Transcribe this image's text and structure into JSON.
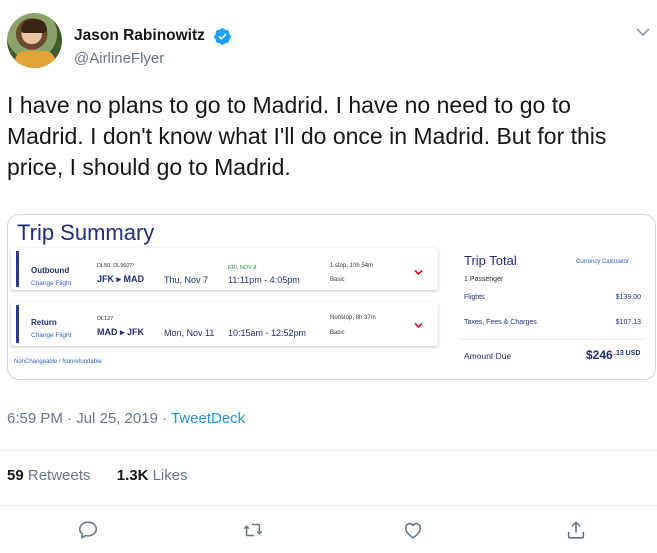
{
  "author": {
    "name": "Jason Rabinowitz",
    "handle": "@AirlineFlyer",
    "verified": true
  },
  "tweet": {
    "text": "I have no plans to go to Madrid. I have no need to go to Madrid. I don't know what I'll do once in Madrid. But for this price, I should go to Madrid."
  },
  "card": {
    "title": "Trip Summary",
    "legs": [
      {
        "label": "Outbound",
        "change": "Change Flight",
        "flight_no": "DL50, DL9607¹",
        "route": "JFK ▸ MAD",
        "date": "Thu, Nov 7",
        "next_day": "FRI, NOV 8",
        "times": "11:11pm - 4:05pm",
        "stops": "1 stop, 10h 54m",
        "fare": "Basic"
      },
      {
        "label": "Return",
        "change": "Change Flight",
        "flight_no": "DL127",
        "route": "MAD ▸ JFK",
        "date": "Mon, Nov 11",
        "next_day": "",
        "times": "10:15am - 12:52pm",
        "stops": "Nonstop, 8h 37m",
        "fare": "Basic"
      }
    ],
    "fare_note": "NonChangeable / Nonrefundable",
    "total": {
      "title": "Trip Total",
      "currency_link": "Currency Calculator",
      "passengers": "1 Passenger",
      "flights_label": "Flights",
      "flights_value": "$139.00",
      "taxes_label": "Taxes, Fees & Charges",
      "taxes_value": "$107.13",
      "amount_label": "Amount Due",
      "amount_value": "$246",
      "amount_cents": ".13 USD"
    }
  },
  "meta": {
    "time": "6:59 PM · Jul 25, 2019 · ",
    "source": "TweetDeck"
  },
  "stats": {
    "retweets_count": "59",
    "retweets_label": " Retweets",
    "likes_count": "1.3K",
    "likes_label": " Likes"
  },
  "colors": {
    "accent": "#1b95e0",
    "card_navy": "#1f2d7a",
    "delta_red": "#c8102e"
  },
  "icons": [
    "verified-badge-icon",
    "caret-down-icon",
    "reply-icon",
    "retweet-icon",
    "like-icon",
    "share-icon"
  ]
}
